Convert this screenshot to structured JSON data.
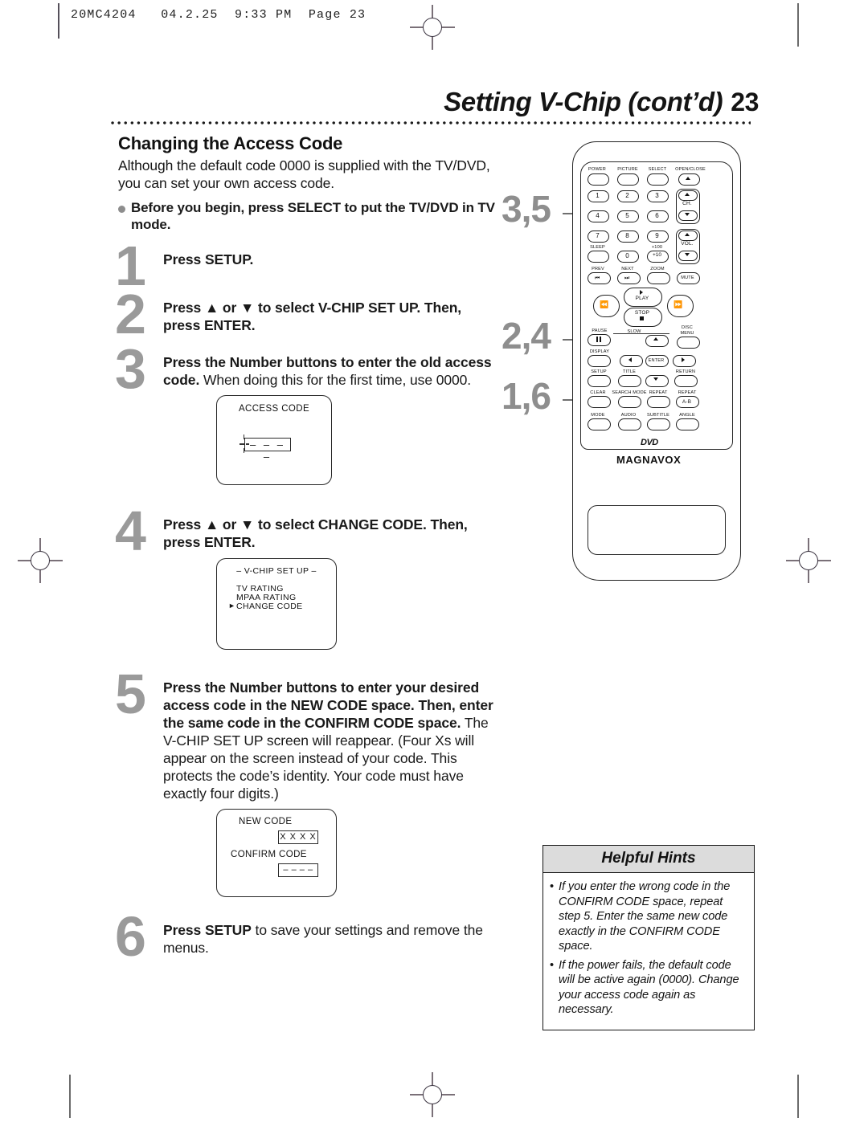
{
  "print_header": "20MC4204   04.2.25  9:33 PM  Page 23",
  "page": {
    "title": "Setting V-Chip (cont’d)",
    "number": "23",
    "section_heading": "Changing the Access Code",
    "intro": "Although the default code 0000 is supplied with the TV/DVD, you can set your own access code.",
    "before_note": "Before you begin, press SELECT to put the TV/DVD in TV mode."
  },
  "steps": [
    {
      "num": "1",
      "bold": "Press SETUP.",
      "rest": ""
    },
    {
      "num": "2",
      "bold": "Press ▲ or ▼ to select V-CHIP SET UP. Then, press ENTER.",
      "rest": ""
    },
    {
      "num": "3",
      "bold": "Press the Number buttons to enter the old access code.",
      "rest": " When doing this for the first time, use 0000."
    },
    {
      "num": "4",
      "bold": "Press ▲ or ▼ to select CHANGE CODE. Then, press ENTER.",
      "rest": ""
    },
    {
      "num": "5",
      "bold": "Press the Number buttons to enter your desired access code in the NEW CODE space. Then, enter the same code in the CONFIRM CODE space.",
      "rest": " The V-CHIP SET UP screen will reappear. (Four Xs will appear on the screen instead of your code. This protects the code’s identity. Your code must have exactly four digits.)"
    },
    {
      "num": "6",
      "bold": "Press SETUP",
      "rest": " to save your settings and remove the menus."
    }
  ],
  "osd": {
    "access_code": {
      "title": "ACCESS CODE",
      "value": "– – – –"
    },
    "vchip_menu": {
      "title": "– V-CHIP SET UP –",
      "items": [
        "TV RATING",
        "MPAA RATING",
        "CHANGE CODE"
      ],
      "selected_marker": "►",
      "selected_index": 2
    },
    "code_entry": {
      "new_label": "NEW CODE",
      "new_value": "X X X X",
      "confirm_label": "CONFIRM CODE",
      "confirm_value": "– – – –"
    }
  },
  "callouts": [
    {
      "label": "3,5"
    },
    {
      "label": "2,4"
    },
    {
      "label": "1,6"
    }
  ],
  "remote": {
    "brand": "MAGNAVOX",
    "disc_logo": "DVD",
    "row_top": [
      "POWER",
      "PICTURE",
      "SELECT",
      "OPEN/CLOSE"
    ],
    "numbers": [
      "1",
      "2",
      "3",
      "4",
      "5",
      "6",
      "7",
      "8",
      "9",
      "0"
    ],
    "ch_label": "CH.",
    "vol_label": "VOL.",
    "sleep": "SLEEP",
    "plus100": "+100",
    "plus10": "+10",
    "prev": "PREV",
    "next": "NEXT",
    "zoom": "ZOOM",
    "mute": "MUTE",
    "play": "PLAY",
    "stop": "STOP",
    "slow": "SLOW",
    "pause": "PAUSE",
    "disc_menu_1": "DISC",
    "disc_menu_2": "MENU",
    "display": "DISPLAY",
    "setup": "SETUP",
    "title_btn": "TITLE",
    "enter": "ENTER",
    "return": "RETURN",
    "clear": "CLEAR",
    "search_mode": "SEARCH MODE",
    "repeat": "REPEAT",
    "repeat2": "REPEAT",
    "repeat_ab": "A-B",
    "mode": "MODE",
    "audio": "AUDIO",
    "subtitle": "SUBTITLE",
    "angle": "ANGLE"
  },
  "hints": {
    "title": "Helpful Hints",
    "items": [
      "If you enter the wrong code in the CONFIRM CODE space, repeat step 5. Enter the same new code exactly in the CONFIRM CODE space.",
      "If the power fails, the default code will be active again (0000). Change your access code again as necessary."
    ],
    "bullet": "•"
  }
}
